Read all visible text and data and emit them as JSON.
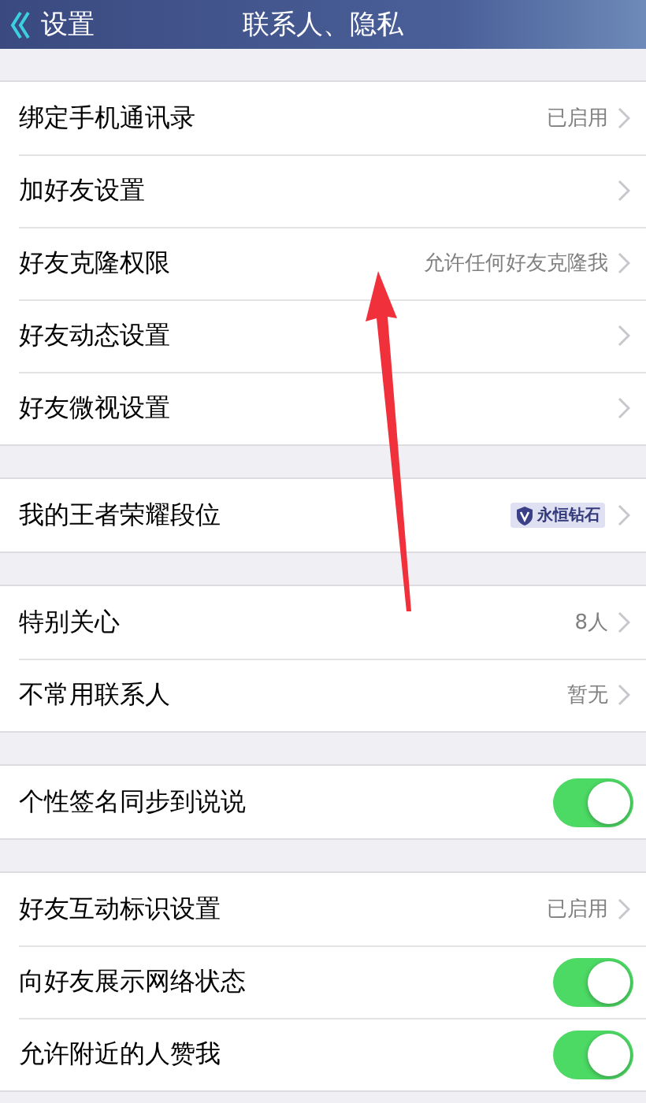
{
  "nav": {
    "back": "设置",
    "title": "联系人、隐私"
  },
  "sections": [
    {
      "rows": [
        {
          "kind": "link",
          "label": "绑定手机通讯录",
          "value": "已启用"
        },
        {
          "kind": "link",
          "label": "加好友设置"
        },
        {
          "kind": "link",
          "label": "好友克隆权限",
          "value": "允许任何好友克隆我"
        },
        {
          "kind": "link",
          "label": "好友动态设置"
        },
        {
          "kind": "link",
          "label": "好友微视设置"
        }
      ]
    },
    {
      "rows": [
        {
          "kind": "badge",
          "label": "我的王者荣耀段位",
          "value": "永恒钻石"
        }
      ]
    },
    {
      "rows": [
        {
          "kind": "link",
          "label": "特别关心",
          "value": "8人"
        },
        {
          "kind": "link",
          "label": "不常用联系人",
          "value": "暂无"
        }
      ]
    },
    {
      "rows": [
        {
          "kind": "toggle",
          "label": "个性签名同步到说说",
          "on": true
        }
      ]
    },
    {
      "rows": [
        {
          "kind": "link",
          "label": "好友互动标识设置",
          "value": "已启用"
        },
        {
          "kind": "toggle",
          "label": "向好友展示网络状态",
          "on": true
        },
        {
          "kind": "toggle",
          "label": "允许附近的人赞我",
          "on": true
        }
      ]
    }
  ]
}
